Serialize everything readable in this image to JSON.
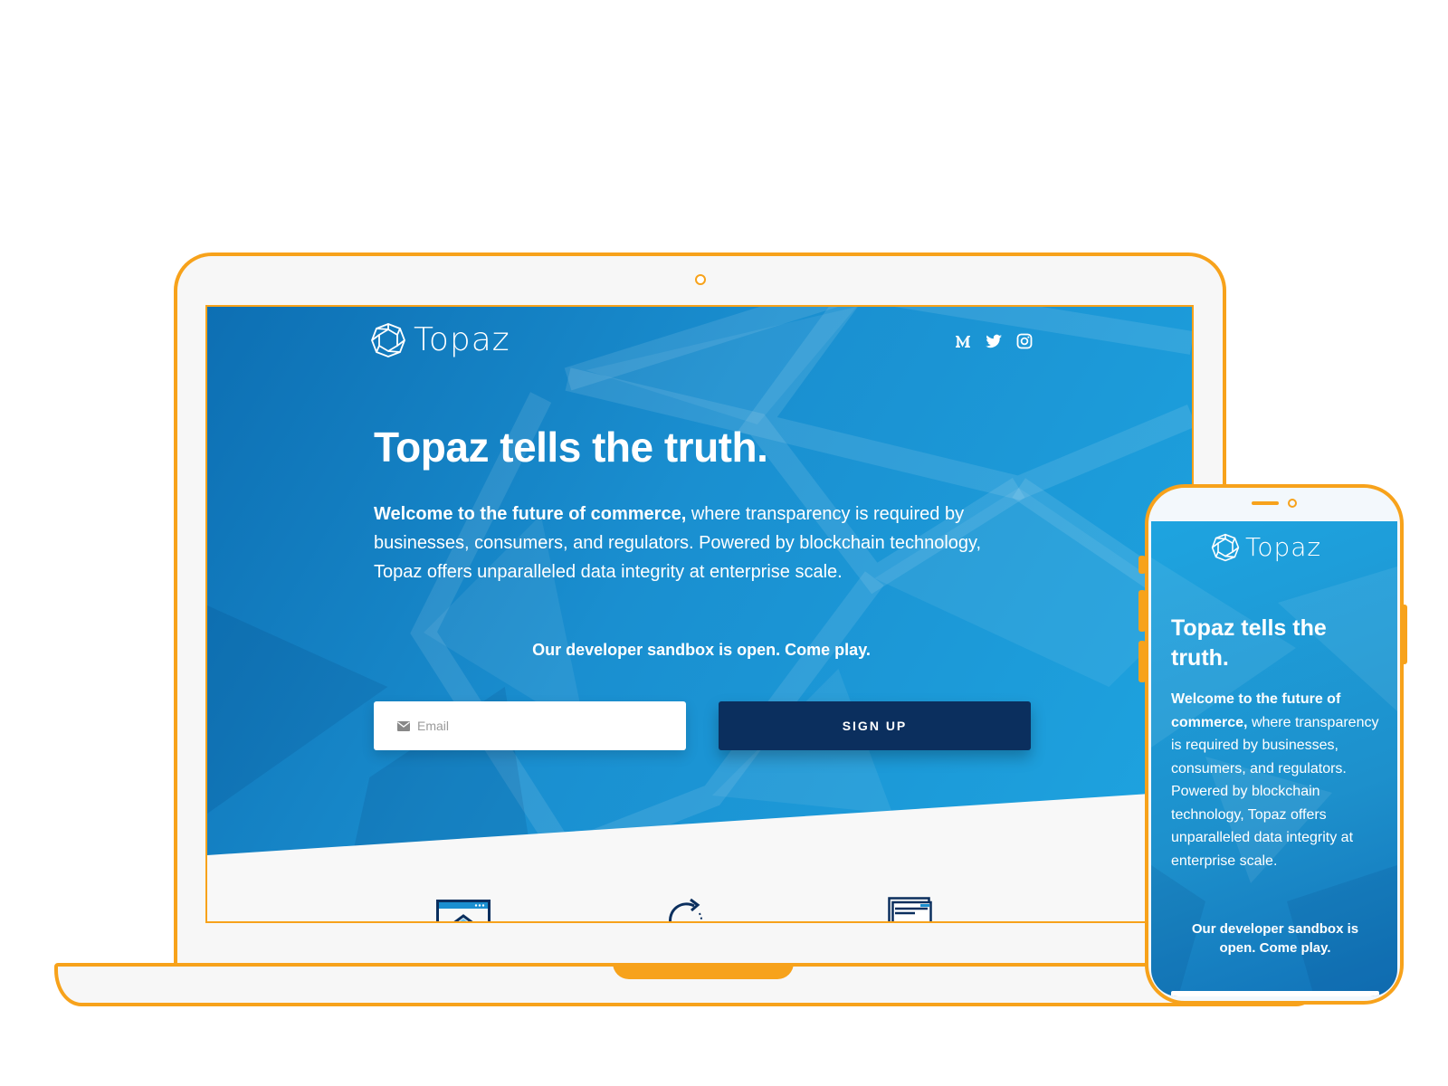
{
  "colors": {
    "accent": "#f7a21b",
    "hero_blue": "#1a8fd0",
    "button_navy": "#0b2f5e",
    "text_on_hero": "#ffffff"
  },
  "desktop": {
    "logo_text": "Topaz",
    "social_icons": [
      "medium-icon",
      "twitter-icon",
      "instagram-icon"
    ],
    "hero_title": "Topaz tells the truth.",
    "intro_bold": "Welcome to the future of commerce,",
    "intro_rest": " where transparency is required by businesses, consumers, and regulators. Powered by blockchain technology, Topaz offers unparalleled data integrity at enterprise scale.",
    "sandbox_text": "Our developer sandbox is open. Come play.",
    "email_placeholder": "Email",
    "signup_label": "SIGN UP",
    "feature_icons": [
      "dashboard-icon",
      "sync-arrow-icon",
      "stacked-windows-icon"
    ]
  },
  "mobile": {
    "logo_text": "Topaz",
    "hero_title": "Topaz tells the truth.",
    "intro_bold": "Welcome to the future of commerce,",
    "intro_rest": " where transparency is required by businesses, consumers, and regulators. Powered by blockchain technology, Topaz offers unparalleled data integrity at enterprise scale.",
    "sandbox_text": "Our developer sandbox is open. Come play."
  }
}
